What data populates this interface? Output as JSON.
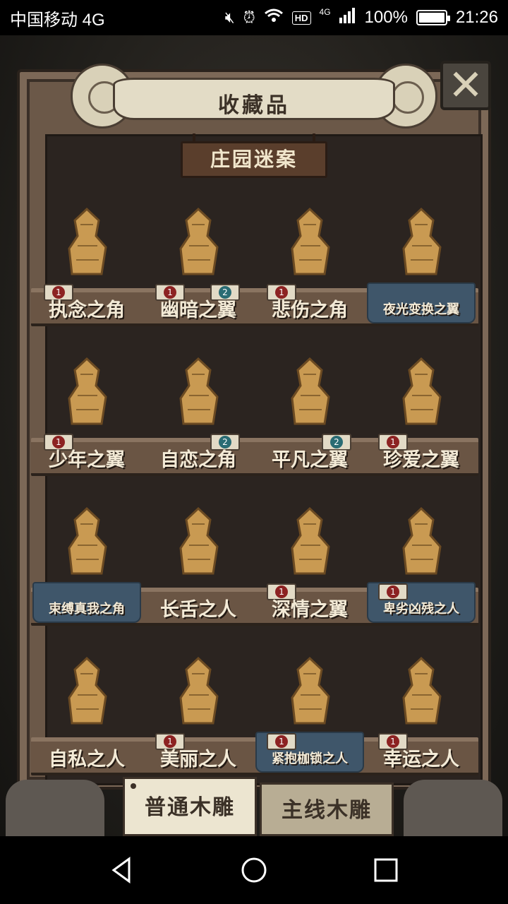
{
  "status_bar": {
    "carrier": "中国移动 4G",
    "signal_label": "4G",
    "hd_label": "HD",
    "battery": "100%",
    "time": "21:26"
  },
  "window": {
    "title": "收藏品",
    "section_sign": "庄园迷案"
  },
  "shelves": [
    [
      {
        "name": "执念之角",
        "badges": [
          "1"
        ],
        "cloth": false
      },
      {
        "name": "幽暗之翼",
        "badges": [
          "1",
          "2"
        ],
        "cloth": false
      },
      {
        "name": "悲伤之角",
        "badges": [
          "1"
        ],
        "cloth": false
      },
      {
        "name": "夜光变换之翼",
        "badges": [],
        "cloth": true
      }
    ],
    [
      {
        "name": "少年之翼",
        "badges": [
          "1"
        ],
        "cloth": false
      },
      {
        "name": "自恋之角",
        "badges": [
          "2"
        ],
        "cloth": false
      },
      {
        "name": "平凡之翼",
        "badges": [
          "2"
        ],
        "cloth": false
      },
      {
        "name": "珍爱之翼",
        "badges": [
          "1"
        ],
        "cloth": false
      }
    ],
    [
      {
        "name": "束缚真我之角",
        "badges": [],
        "cloth": true
      },
      {
        "name": "长舌之人",
        "badges": [],
        "cloth": false
      },
      {
        "name": "深情之翼",
        "badges": [
          "1"
        ],
        "cloth": false
      },
      {
        "name": "卑劣凶残之人",
        "badges": [
          "1"
        ],
        "cloth": true
      }
    ],
    [
      {
        "name": "自私之人",
        "badges": [],
        "cloth": false
      },
      {
        "name": "美丽之人",
        "badges": [
          "1"
        ],
        "cloth": false
      },
      {
        "name": "紧抱枷锁之人",
        "badges": [
          "1"
        ],
        "cloth": true
      },
      {
        "name": "幸运之人",
        "badges": [
          "1"
        ],
        "cloth": false
      }
    ]
  ],
  "tabs": {
    "normal": "普通木雕",
    "main": "主线木雕"
  },
  "colors": {
    "wood": "#c99a52",
    "cabinet": "#6b5848",
    "badge_red": "#8c2222",
    "badge_teal": "#2a6c74",
    "cloth": "#3f566a"
  }
}
